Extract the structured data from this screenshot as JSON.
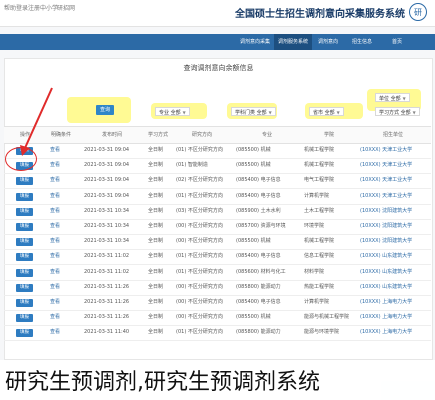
{
  "topbar": {
    "links": [
      "帮助",
      "登录",
      "注册",
      "中小学",
      "研招网"
    ],
    "site_title": "全国硕士生招生调剂意向采集服务系统",
    "logo_glyph": "研"
  },
  "nav": {
    "items": [
      "调剂意向采集",
      "调剂服务系统",
      "调剂意向",
      "招生信息",
      "首页"
    ],
    "active_index": 1
  },
  "panel": {
    "title": "查询调剂意向余额信息"
  },
  "search": {
    "button_label": "查询"
  },
  "filters": [
    {
      "label": "专业",
      "value": "全部"
    },
    {
      "label": "学科门类",
      "value": "全部"
    },
    {
      "label": "省市",
      "value": "全部"
    },
    {
      "label": "单位",
      "value": "全部"
    },
    {
      "label": "学习方式",
      "value": "全部"
    }
  ],
  "table": {
    "headers": [
      "操作",
      "明确条件",
      "发布时间",
      "学习方式",
      "研究方向",
      "专业",
      "学院",
      "招生单位"
    ],
    "rows": [
      {
        "op": "填报",
        "cond": "查看",
        "time": "2021-03-31 09:04",
        "mode": "全日制",
        "dir": "(01) 不区分研究方向",
        "major": "(085500) 机械",
        "school": "机械工程学院",
        "unit": "(10XXX) 天津工业大学"
      },
      {
        "op": "填报",
        "cond": "查看",
        "time": "2021-03-31 09:04",
        "mode": "全日制",
        "dir": "(01) 智能制造",
        "major": "(085500) 机械",
        "school": "机械工程学院",
        "unit": "(10XXX) 天津工业大学"
      },
      {
        "op": "填报",
        "cond": "查看",
        "time": "2021-03-31 09:04",
        "mode": "全日制",
        "dir": "(02) 不区分研究方向",
        "major": "(085400) 电子信息",
        "school": "电气工程学院",
        "unit": "(10XXX) 天津工业大学"
      },
      {
        "op": "填报",
        "cond": "查看",
        "time": "2021-03-31 09:04",
        "mode": "全日制",
        "dir": "(01) 不区分研究方向",
        "major": "(085400) 电子信息",
        "school": "计算机学院",
        "unit": "(10XXX) 天津工业大学"
      },
      {
        "op": "填报",
        "cond": "查看",
        "time": "2021-03-31 10:34",
        "mode": "全日制",
        "dir": "(03) 不区分研究方向",
        "major": "(085900) 土木水利",
        "school": "土木工程学院",
        "unit": "(10XXX) 沈阳建筑大学"
      },
      {
        "op": "填报",
        "cond": "查看",
        "time": "2021-03-31 10:34",
        "mode": "全日制",
        "dir": "(00) 不区分研究方向",
        "major": "(085700) 资源与环境",
        "school": "环境学院",
        "unit": "(10XXX) 沈阳建筑大学"
      },
      {
        "op": "填报",
        "cond": "查看",
        "time": "2021-03-31 10:34",
        "mode": "全日制",
        "dir": "(00) 不区分研究方向",
        "major": "(085500) 机械",
        "school": "机械工程学院",
        "unit": "(10XXX) 沈阳建筑大学"
      },
      {
        "op": "填报",
        "cond": "查看",
        "time": "2021-03-31 11:02",
        "mode": "全日制",
        "dir": "(01) 不区分研究方向",
        "major": "(085400) 电子信息",
        "school": "信息工程学院",
        "unit": "(10XXX) 山东建筑大学"
      },
      {
        "op": "填报",
        "cond": "查看",
        "time": "2021-03-31 11:02",
        "mode": "全日制",
        "dir": "(01) 不区分研究方向",
        "major": "(085600) 材料与化工",
        "school": "材料学院",
        "unit": "(10XXX) 山东建筑大学"
      },
      {
        "op": "填报",
        "cond": "查看",
        "time": "2021-03-31 11:26",
        "mode": "全日制",
        "dir": "(00) 不区分研究方向",
        "major": "(085800) 能源动力",
        "school": "热能工程学院",
        "unit": "(10XXX) 山东建筑大学"
      },
      {
        "op": "填报",
        "cond": "查看",
        "time": "2021-03-31 11:26",
        "mode": "全日制",
        "dir": "(00) 不区分研究方向",
        "major": "(085400) 电子信息",
        "school": "计算机学院",
        "unit": "(10XXX) 上海电力大学"
      },
      {
        "op": "填报",
        "cond": "查看",
        "time": "2021-03-31 11:26",
        "mode": "全日制",
        "dir": "(00) 不区分研究方向",
        "major": "(085500) 机械",
        "school": "能源与机械工程学院",
        "unit": "(10XXX) 上海电力大学"
      },
      {
        "op": "填报",
        "cond": "查看",
        "time": "2021-03-31 11:40",
        "mode": "全日制",
        "dir": "(01) 不区分研究方向",
        "major": "(085800) 能源动力",
        "school": "能源与环境学院",
        "unit": "(10XXX) 上海电力大学"
      }
    ]
  },
  "caption": "研究生预调剂,研究生预调剂系统"
}
